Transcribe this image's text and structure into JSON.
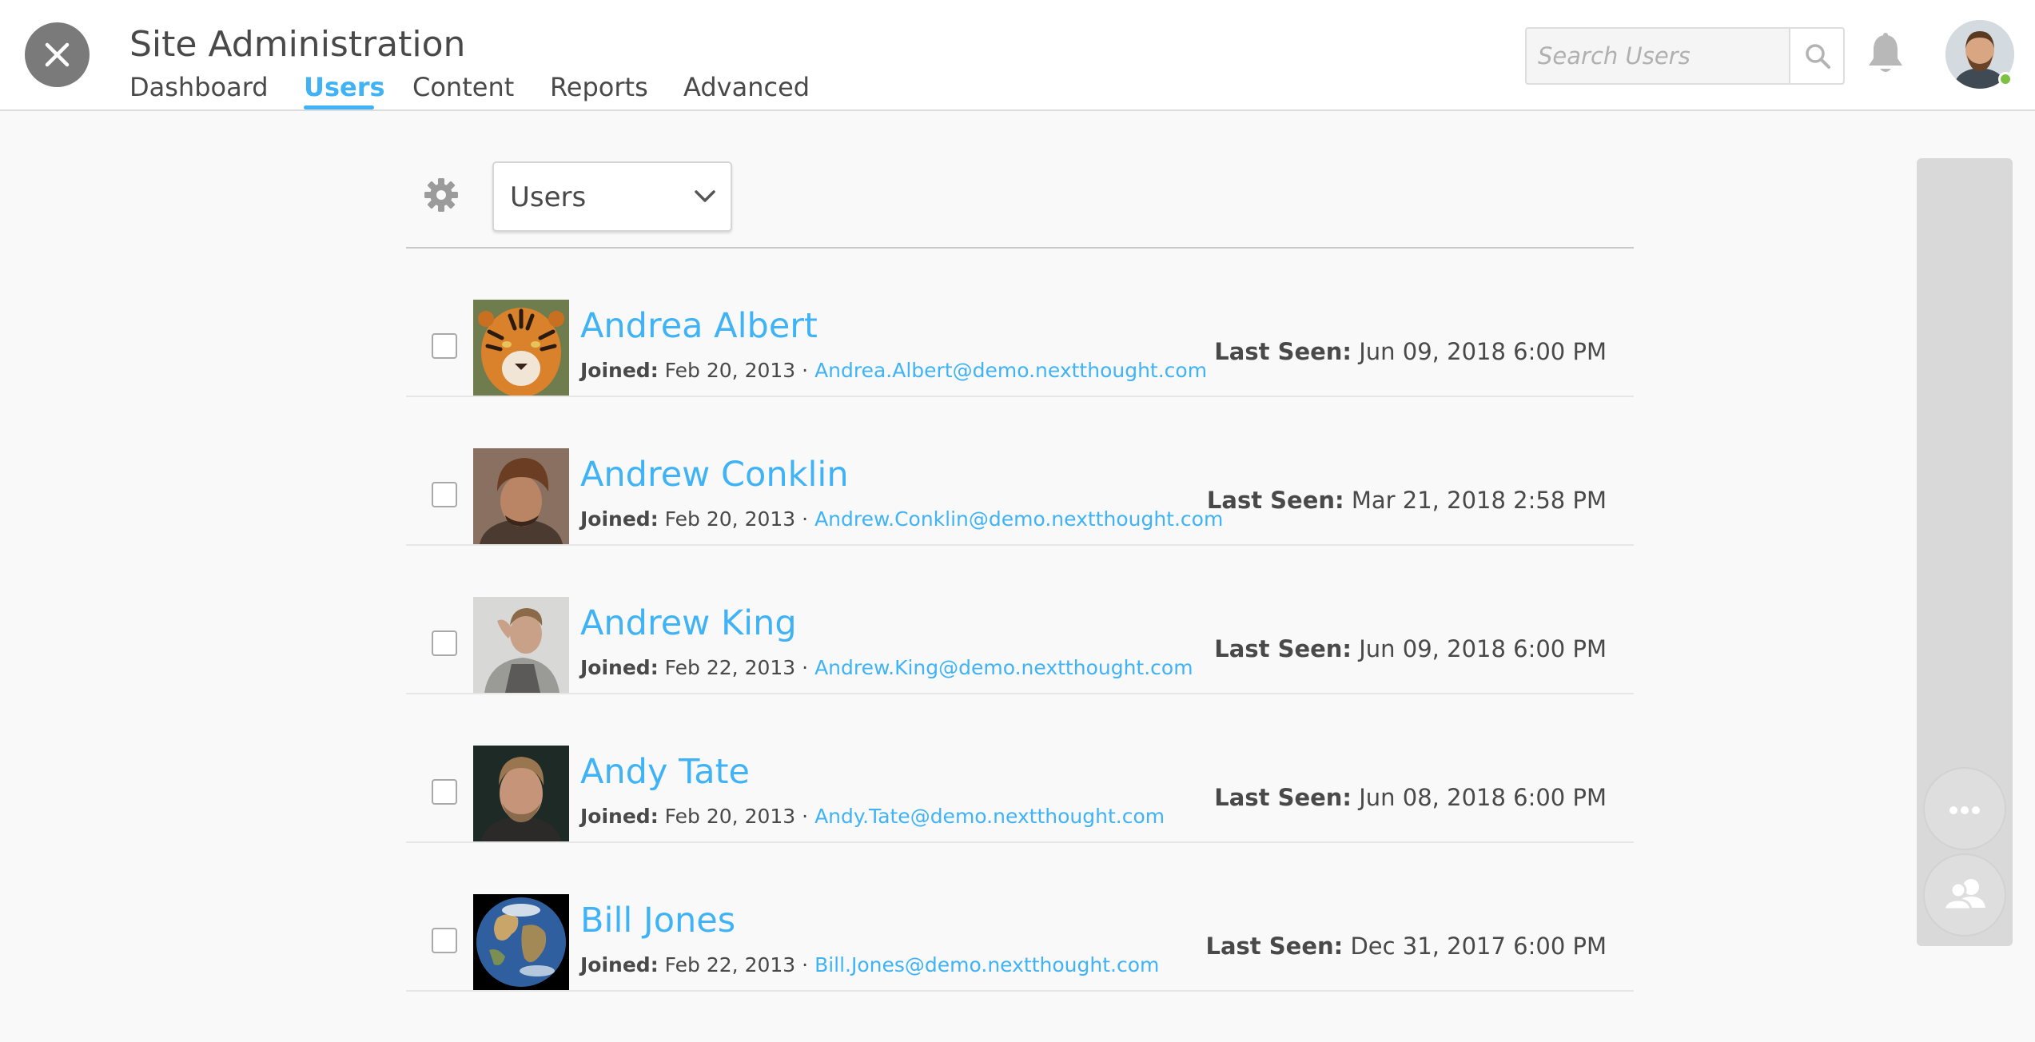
{
  "header": {
    "title": "Site Administration",
    "tabs": [
      {
        "label": "Dashboard",
        "active": false
      },
      {
        "label": "Users",
        "active": true
      },
      {
        "label": "Content",
        "active": false
      },
      {
        "label": "Reports",
        "active": false
      },
      {
        "label": "Advanced",
        "active": false
      }
    ],
    "search": {
      "placeholder": "Search Users",
      "value": ""
    },
    "icons": {
      "close": "close-icon",
      "search": "search-icon",
      "notifications": "bell-icon",
      "presence": "online-status-dot"
    }
  },
  "toolbar": {
    "settings_icon": "gear-icon",
    "filter": {
      "selected": "Users",
      "icon": "chevron-down-icon"
    }
  },
  "labels": {
    "joined": "Joined:",
    "last_seen": "Last Seen:",
    "separator": "·"
  },
  "users": [
    {
      "name": "Andrea Albert",
      "joined": "Feb 20, 2013",
      "email": "Andrea.Albert@demo.nextthought.com",
      "last_seen": "Jun 09, 2018 6:00 PM",
      "avatar": "tiger"
    },
    {
      "name": "Andrew Conklin",
      "joined": "Feb 20, 2013",
      "email": "Andrew.Conklin@demo.nextthought.com",
      "last_seen": "Mar 21, 2018 2:58 PM",
      "avatar": "man-beanie"
    },
    {
      "name": "Andrew King",
      "joined": "Feb 22, 2013",
      "email": "Andrew.King@demo.nextthought.com",
      "last_seen": "Jun 09, 2018 6:00 PM",
      "avatar": "man-plaid-shirt"
    },
    {
      "name": "Andy Tate",
      "joined": "Feb 20, 2013",
      "email": "Andy.Tate@demo.nextthought.com",
      "last_seen": "Jun 08, 2018 6:00 PM",
      "avatar": "man-portrait-dark"
    },
    {
      "name": "Bill Jones",
      "joined": "Feb 22, 2013",
      "email": "Bill.Jones@demo.nextthought.com",
      "last_seen": "Dec 31, 2017 6:00 PM",
      "avatar": "earth"
    }
  ],
  "side_panel": {
    "buttons": [
      {
        "icon": "more-options-icon"
      },
      {
        "icon": "contacts-icon"
      }
    ]
  },
  "colors": {
    "accent": "#3fb3f6",
    "text": "#494949",
    "background": "#f9f9f9",
    "presence_online": "#7dc143"
  }
}
